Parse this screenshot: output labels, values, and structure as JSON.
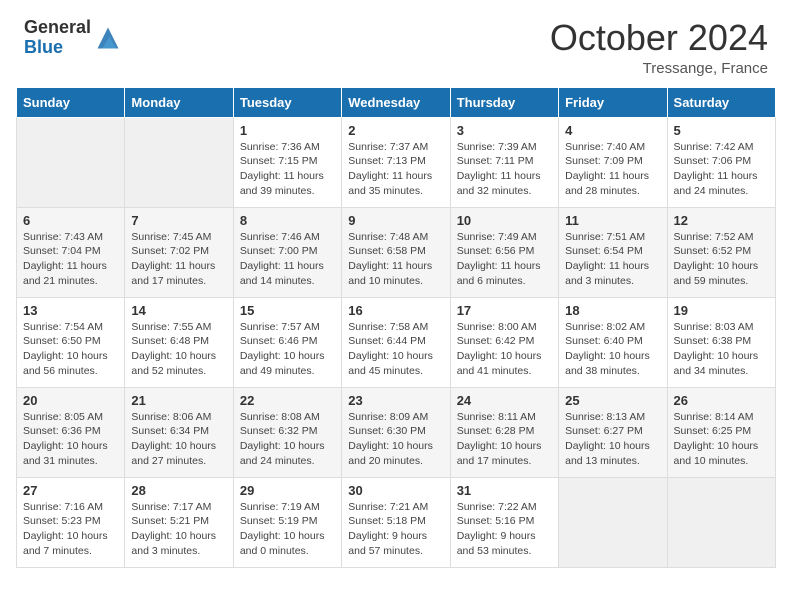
{
  "header": {
    "logo_general": "General",
    "logo_blue": "Blue",
    "month": "October 2024",
    "location": "Tressange, France"
  },
  "days_of_week": [
    "Sunday",
    "Monday",
    "Tuesday",
    "Wednesday",
    "Thursday",
    "Friday",
    "Saturday"
  ],
  "weeks": [
    [
      {
        "day": "",
        "sunrise": "",
        "sunset": "",
        "daylight": ""
      },
      {
        "day": "",
        "sunrise": "",
        "sunset": "",
        "daylight": ""
      },
      {
        "day": "1",
        "sunrise": "Sunrise: 7:36 AM",
        "sunset": "Sunset: 7:15 PM",
        "daylight": "Daylight: 11 hours and 39 minutes."
      },
      {
        "day": "2",
        "sunrise": "Sunrise: 7:37 AM",
        "sunset": "Sunset: 7:13 PM",
        "daylight": "Daylight: 11 hours and 35 minutes."
      },
      {
        "day": "3",
        "sunrise": "Sunrise: 7:39 AM",
        "sunset": "Sunset: 7:11 PM",
        "daylight": "Daylight: 11 hours and 32 minutes."
      },
      {
        "day": "4",
        "sunrise": "Sunrise: 7:40 AM",
        "sunset": "Sunset: 7:09 PM",
        "daylight": "Daylight: 11 hours and 28 minutes."
      },
      {
        "day": "5",
        "sunrise": "Sunrise: 7:42 AM",
        "sunset": "Sunset: 7:06 PM",
        "daylight": "Daylight: 11 hours and 24 minutes."
      }
    ],
    [
      {
        "day": "6",
        "sunrise": "Sunrise: 7:43 AM",
        "sunset": "Sunset: 7:04 PM",
        "daylight": "Daylight: 11 hours and 21 minutes."
      },
      {
        "day": "7",
        "sunrise": "Sunrise: 7:45 AM",
        "sunset": "Sunset: 7:02 PM",
        "daylight": "Daylight: 11 hours and 17 minutes."
      },
      {
        "day": "8",
        "sunrise": "Sunrise: 7:46 AM",
        "sunset": "Sunset: 7:00 PM",
        "daylight": "Daylight: 11 hours and 14 minutes."
      },
      {
        "day": "9",
        "sunrise": "Sunrise: 7:48 AM",
        "sunset": "Sunset: 6:58 PM",
        "daylight": "Daylight: 11 hours and 10 minutes."
      },
      {
        "day": "10",
        "sunrise": "Sunrise: 7:49 AM",
        "sunset": "Sunset: 6:56 PM",
        "daylight": "Daylight: 11 hours and 6 minutes."
      },
      {
        "day": "11",
        "sunrise": "Sunrise: 7:51 AM",
        "sunset": "Sunset: 6:54 PM",
        "daylight": "Daylight: 11 hours and 3 minutes."
      },
      {
        "day": "12",
        "sunrise": "Sunrise: 7:52 AM",
        "sunset": "Sunset: 6:52 PM",
        "daylight": "Daylight: 10 hours and 59 minutes."
      }
    ],
    [
      {
        "day": "13",
        "sunrise": "Sunrise: 7:54 AM",
        "sunset": "Sunset: 6:50 PM",
        "daylight": "Daylight: 10 hours and 56 minutes."
      },
      {
        "day": "14",
        "sunrise": "Sunrise: 7:55 AM",
        "sunset": "Sunset: 6:48 PM",
        "daylight": "Daylight: 10 hours and 52 minutes."
      },
      {
        "day": "15",
        "sunrise": "Sunrise: 7:57 AM",
        "sunset": "Sunset: 6:46 PM",
        "daylight": "Daylight: 10 hours and 49 minutes."
      },
      {
        "day": "16",
        "sunrise": "Sunrise: 7:58 AM",
        "sunset": "Sunset: 6:44 PM",
        "daylight": "Daylight: 10 hours and 45 minutes."
      },
      {
        "day": "17",
        "sunrise": "Sunrise: 8:00 AM",
        "sunset": "Sunset: 6:42 PM",
        "daylight": "Daylight: 10 hours and 41 minutes."
      },
      {
        "day": "18",
        "sunrise": "Sunrise: 8:02 AM",
        "sunset": "Sunset: 6:40 PM",
        "daylight": "Daylight: 10 hours and 38 minutes."
      },
      {
        "day": "19",
        "sunrise": "Sunrise: 8:03 AM",
        "sunset": "Sunset: 6:38 PM",
        "daylight": "Daylight: 10 hours and 34 minutes."
      }
    ],
    [
      {
        "day": "20",
        "sunrise": "Sunrise: 8:05 AM",
        "sunset": "Sunset: 6:36 PM",
        "daylight": "Daylight: 10 hours and 31 minutes."
      },
      {
        "day": "21",
        "sunrise": "Sunrise: 8:06 AM",
        "sunset": "Sunset: 6:34 PM",
        "daylight": "Daylight: 10 hours and 27 minutes."
      },
      {
        "day": "22",
        "sunrise": "Sunrise: 8:08 AM",
        "sunset": "Sunset: 6:32 PM",
        "daylight": "Daylight: 10 hours and 24 minutes."
      },
      {
        "day": "23",
        "sunrise": "Sunrise: 8:09 AM",
        "sunset": "Sunset: 6:30 PM",
        "daylight": "Daylight: 10 hours and 20 minutes."
      },
      {
        "day": "24",
        "sunrise": "Sunrise: 8:11 AM",
        "sunset": "Sunset: 6:28 PM",
        "daylight": "Daylight: 10 hours and 17 minutes."
      },
      {
        "day": "25",
        "sunrise": "Sunrise: 8:13 AM",
        "sunset": "Sunset: 6:27 PM",
        "daylight": "Daylight: 10 hours and 13 minutes."
      },
      {
        "day": "26",
        "sunrise": "Sunrise: 8:14 AM",
        "sunset": "Sunset: 6:25 PM",
        "daylight": "Daylight: 10 hours and 10 minutes."
      }
    ],
    [
      {
        "day": "27",
        "sunrise": "Sunrise: 7:16 AM",
        "sunset": "Sunset: 5:23 PM",
        "daylight": "Daylight: 10 hours and 7 minutes."
      },
      {
        "day": "28",
        "sunrise": "Sunrise: 7:17 AM",
        "sunset": "Sunset: 5:21 PM",
        "daylight": "Daylight: 10 hours and 3 minutes."
      },
      {
        "day": "29",
        "sunrise": "Sunrise: 7:19 AM",
        "sunset": "Sunset: 5:19 PM",
        "daylight": "Daylight: 10 hours and 0 minutes."
      },
      {
        "day": "30",
        "sunrise": "Sunrise: 7:21 AM",
        "sunset": "Sunset: 5:18 PM",
        "daylight": "Daylight: 9 hours and 57 minutes."
      },
      {
        "day": "31",
        "sunrise": "Sunrise: 7:22 AM",
        "sunset": "Sunset: 5:16 PM",
        "daylight": "Daylight: 9 hours and 53 minutes."
      },
      {
        "day": "",
        "sunrise": "",
        "sunset": "",
        "daylight": ""
      },
      {
        "day": "",
        "sunrise": "",
        "sunset": "",
        "daylight": ""
      }
    ]
  ]
}
